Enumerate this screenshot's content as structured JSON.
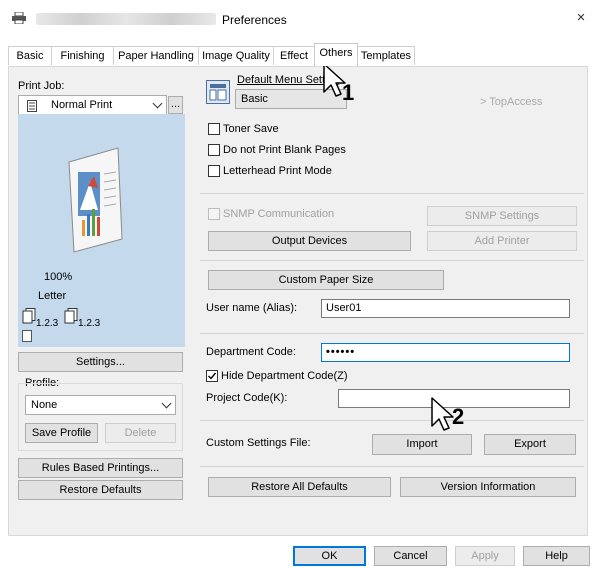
{
  "window": {
    "title": "Preferences",
    "close": "×"
  },
  "tabs": [
    "Basic",
    "Finishing",
    "Paper Handling",
    "Image Quality",
    "Effect",
    "Others",
    "Templates"
  ],
  "left": {
    "print_job_label": "Print Job:",
    "print_job_value": "Normal Print",
    "more_button": "...",
    "zoom": "100%",
    "paper": "Letter",
    "collate_a": "1.2.3",
    "collate_b": "1.2.3",
    "settings_button": "Settings...",
    "profile_label": "Profile:",
    "profile_value": "None",
    "save_profile": "Save Profile",
    "delete": "Delete",
    "rules_based": "Rules Based Printings...",
    "restore_defaults": "Restore Defaults"
  },
  "right": {
    "default_menu_label": "Default Menu Setting",
    "default_menu_value": "Basic",
    "topaccess": "> TopAccess",
    "toner_save": "Toner Save",
    "no_blank": "Do not Print Blank Pages",
    "letterhead": "Letterhead Print Mode",
    "snmp": "SNMP Communication",
    "snmp_settings": "SNMP Settings",
    "output_devices": "Output Devices",
    "add_printer": "Add Printer",
    "custom_paper": "Custom Paper Size",
    "user_name_label": "User name (Alias):",
    "user_name_value": "User01",
    "dept_code_label": "Department Code:",
    "dept_code_value": "••••••",
    "hide_dept": "Hide Department Code(Z)",
    "project_code_label": "Project Code(K):",
    "project_code_value": "",
    "custom_settings_label": "Custom Settings File:",
    "import": "Import",
    "export": "Export",
    "restore_all": "Restore All Defaults",
    "version_info": "Version Information"
  },
  "footer": {
    "ok": "OK",
    "cancel": "Cancel",
    "apply": "Apply",
    "help": "Help"
  },
  "callouts": {
    "one": "1",
    "two": "2"
  },
  "colors": {
    "accent": "#0078d7",
    "preview_bg": "#c4d9ec"
  }
}
